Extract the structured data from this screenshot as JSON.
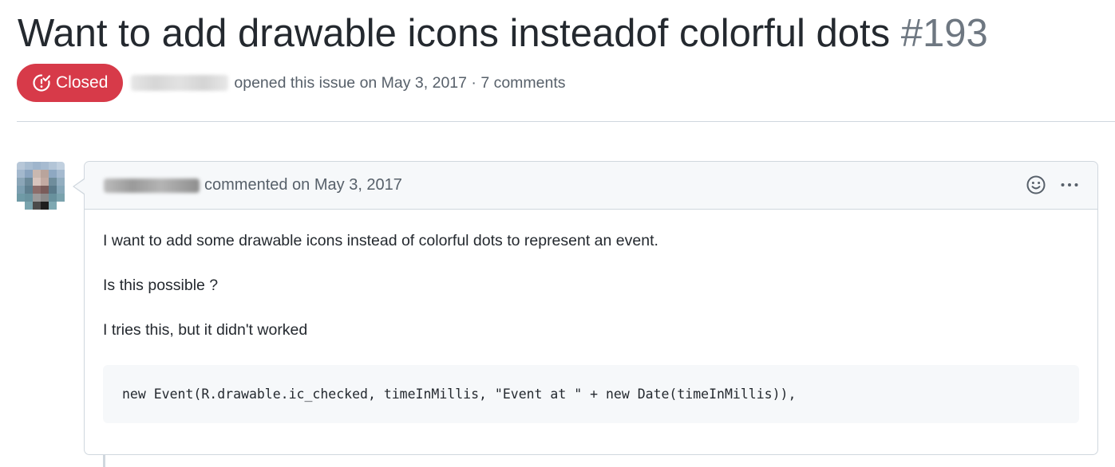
{
  "issue": {
    "title": "Want to add drawable icons insteadof colorful dots",
    "number": "#193",
    "state": "Closed",
    "state_color": "#d73a49",
    "state_icon": "issue-closed-icon",
    "meta_text": "opened this issue on May 3, 2017 · 7 comments"
  },
  "comment": {
    "header_text": "commented on May 3, 2017",
    "reaction_icon": "smiley-icon",
    "menu_icon": "kebab-horizontal-icon",
    "paragraphs": [
      "I want to add some drawable icons instead of colorful dots to represent an event.",
      "Is this possible ?",
      "I tries this, but it didn't worked"
    ],
    "code": "new Event(R.drawable.ic_checked, timeInMillis, \"Event at \" + new Date(timeInMillis)),"
  }
}
